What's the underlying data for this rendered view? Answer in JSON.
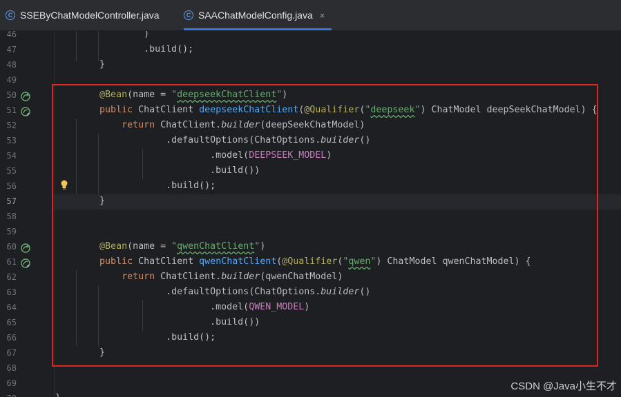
{
  "tabs": [
    {
      "label": "SSEByChatModelController.java",
      "icon": "java-class-icon",
      "active": false
    },
    {
      "label": "SAAChatModelConfig.java",
      "icon": "java-class-icon",
      "active": true,
      "close": "×"
    }
  ],
  "lines": [
    {
      "n": "46",
      "text": "                )"
    },
    {
      "n": "47",
      "text": "                .build();"
    },
    {
      "n": "48",
      "text": "        }"
    },
    {
      "n": "49",
      "text": ""
    },
    {
      "n": "50",
      "text": "        @Bean(name = \"deepseekChatClient\")"
    },
    {
      "n": "51",
      "text": "        public ChatClient deepseekChatClient(@Qualifier(\"deepseek\") ChatModel deepSeekChatModel) {"
    },
    {
      "n": "52",
      "text": "            return ChatClient.builder(deepSeekChatModel)"
    },
    {
      "n": "53",
      "text": "                    .defaultOptions(ChatOptions.builder()"
    },
    {
      "n": "54",
      "text": "                            .model(DEEPSEEK_MODEL)"
    },
    {
      "n": "55",
      "text": "                            .build())"
    },
    {
      "n": "56",
      "text": "                    .build();"
    },
    {
      "n": "57",
      "text": "        }"
    },
    {
      "n": "58",
      "text": ""
    },
    {
      "n": "59",
      "text": ""
    },
    {
      "n": "60",
      "text": "        @Bean(name = \"qwenChatClient\")"
    },
    {
      "n": "61",
      "text": "        public ChatClient qwenChatClient(@Qualifier(\"qwen\") ChatModel qwenChatModel) {"
    },
    {
      "n": "62",
      "text": "            return ChatClient.builder(qwenChatModel)"
    },
    {
      "n": "63",
      "text": "                    .defaultOptions(ChatOptions.builder()"
    },
    {
      "n": "64",
      "text": "                            .model(QWEN_MODEL)"
    },
    {
      "n": "65",
      "text": "                            .build())"
    },
    {
      "n": "66",
      "text": "                    .build();"
    },
    {
      "n": "67",
      "text": "        }"
    },
    {
      "n": "68",
      "text": ""
    },
    {
      "n": "69",
      "text": ""
    },
    {
      "n": "70",
      "text": "}"
    }
  ],
  "gutter_icons": {
    "50": "bean-icon",
    "51": "bean-icon",
    "60": "bean-icon",
    "61": "bean-icon",
    "56": "lightbulb-icon"
  },
  "current_line": "57",
  "watermark": "CSDN @Java小生不才",
  "colors": {
    "highlight_box": "#e0261f",
    "keyword": "#cf8e6d",
    "string": "#6aab73",
    "function": "#56a8f5",
    "annotation": "#b3ae60",
    "constant": "#c77dbb"
  }
}
